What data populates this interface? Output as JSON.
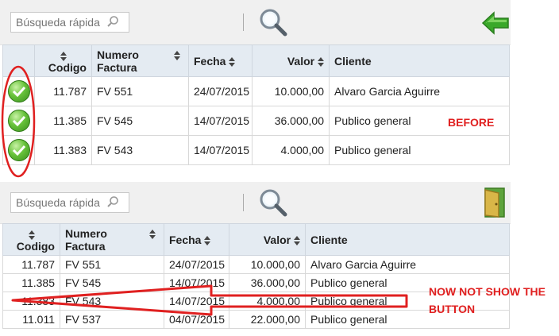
{
  "top": {
    "search_placeholder": "Búsqueda rápida",
    "columns": {
      "codigo": "Codigo",
      "numero_l1": "Numero",
      "numero_l2": "Factura",
      "fecha": "Fecha",
      "valor": "Valor",
      "cliente": "Cliente"
    },
    "rows": [
      {
        "codigo": "11.787",
        "numero": "FV 551",
        "fecha": "24/07/2015",
        "valor": "10.000,00",
        "cliente": "Alvaro Garcia Aguirre"
      },
      {
        "codigo": "11.385",
        "numero": "FV 545",
        "fecha": "14/07/2015",
        "valor": "36.000,00",
        "cliente": "Publico general"
      },
      {
        "codigo": "11.383",
        "numero": "FV 543",
        "fecha": "14/07/2015",
        "valor": "4.000,00",
        "cliente": "Publico general"
      }
    ]
  },
  "bottom": {
    "search_placeholder": "Búsqueda rápida",
    "columns": {
      "codigo": "Codigo",
      "numero_l1": "Numero",
      "numero_l2": "Factura",
      "fecha": "Fecha",
      "valor": "Valor",
      "cliente": "Cliente"
    },
    "rows": [
      {
        "codigo": "11.787",
        "numero": "FV 551",
        "fecha": "24/07/2015",
        "valor": "10.000,00",
        "cliente": "Alvaro Garcia Aguirre"
      },
      {
        "codigo": "11.385",
        "numero": "FV 545",
        "fecha": "14/07/2015",
        "valor": "36.000,00",
        "cliente": "Publico general"
      },
      {
        "codigo": "11.383",
        "numero": "FV 543",
        "fecha": "14/07/2015",
        "valor": "4.000,00",
        "cliente": "Publico general"
      },
      {
        "codigo": "11.011",
        "numero": "FV 537",
        "fecha": "04/07/2015",
        "valor": "22.000,00",
        "cliente": "Publico general"
      }
    ]
  },
  "annotations": {
    "before": "BEFORE",
    "now_line1": "NOW NOT SHOW THE",
    "now_line2": "BUTTON"
  },
  "colors": {
    "annotation_red": "#e02020",
    "header_bg": "#e4ebf2",
    "toolbar_bg": "#f0f0f0",
    "check_green": "#67c23a",
    "arrow_green": "#3aa82a",
    "door": "#d9b648"
  }
}
